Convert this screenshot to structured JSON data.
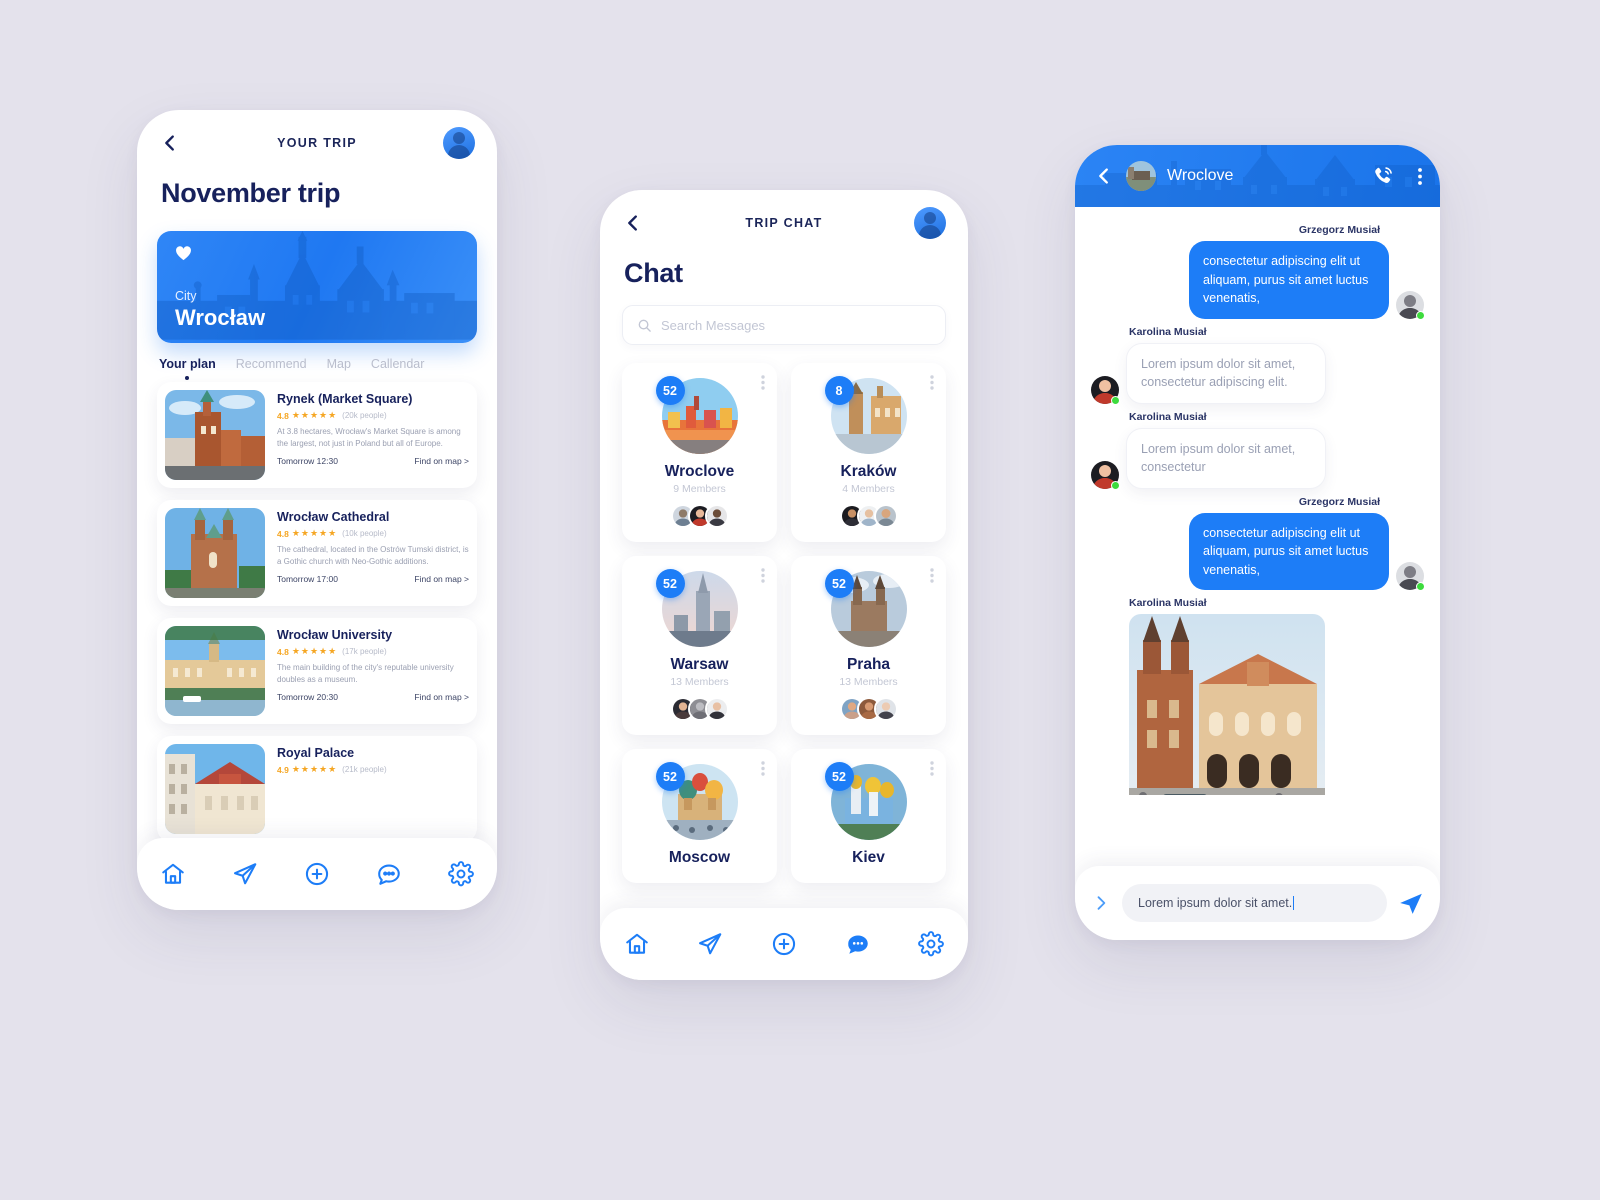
{
  "theme": {
    "background": "#e4e2ec",
    "accent_blue": "#1d7df7",
    "navy": "#17215c",
    "star_orange": "#f5a623",
    "online_green": "#3ddb3d"
  },
  "phone1": {
    "nav_title": "YOUR TRIP",
    "back_icon": "chevron-left-icon",
    "avatar_icon": "user-avatar",
    "page_title": "November trip",
    "hero": {
      "favorite_icon": "heart-icon",
      "label": "City",
      "city": "Wrocław"
    },
    "tabs": [
      {
        "label": "Your plan",
        "active": true
      },
      {
        "label": "Recommend",
        "active": false
      },
      {
        "label": "Map",
        "active": false
      },
      {
        "label": "Callendar",
        "active": false
      }
    ],
    "places": [
      {
        "title": "Rynek (Market Square)",
        "rating": "4.8",
        "stars": "★★★★★",
        "people": "(20k people)",
        "description": "At 3.8 hectares, Wrocław's Market Square is among the largest, not just in Poland but all of Europe.",
        "time": "Tomorrow 12:30",
        "link": "Find on map >"
      },
      {
        "title": "Wrocław Cathedral",
        "rating": "4.8",
        "stars": "★★★★★",
        "people": "(10k people)",
        "description": "The cathedral, located in the Ostrów Tumski district, is a Gothic church with Neo-Gothic additions.",
        "time": "Tomorrow 17:00",
        "link": "Find on map >"
      },
      {
        "title": "Wrocław University",
        "rating": "4.8",
        "stars": "★★★★★",
        "people": "(17k people)",
        "description": "The main building of the city's reputable university doubles as a museum.",
        "time": "Tomorrow 20:30",
        "link": "Find on map >"
      },
      {
        "title": "Royal Palace",
        "rating": "4.9",
        "stars": "★★★★★",
        "people": "(21k people)",
        "description": "",
        "time": "",
        "link": ""
      }
    ],
    "bottom_nav": [
      {
        "icon": "home-icon",
        "active": false
      },
      {
        "icon": "paper-plane-icon",
        "active": false
      },
      {
        "icon": "plus-circle-icon",
        "active": false
      },
      {
        "icon": "chat-bubble-icon",
        "active": false
      },
      {
        "icon": "gear-icon",
        "active": false
      }
    ]
  },
  "phone2": {
    "nav_title": "TRIP CHAT",
    "back_icon": "chevron-left-icon",
    "avatar_icon": "user-avatar",
    "page_title": "Chat",
    "search": {
      "icon": "search-icon",
      "placeholder": "Search Messages"
    },
    "groups": [
      {
        "name": "Wroclove",
        "badge": "52",
        "members": "9 Members",
        "menu_icon": "kebab-menu-icon"
      },
      {
        "name": "Kraków",
        "badge": "8",
        "members": "4 Members",
        "menu_icon": "kebab-menu-icon"
      },
      {
        "name": "Warsaw",
        "badge": "52",
        "members": "13 Members",
        "menu_icon": "kebab-menu-icon"
      },
      {
        "name": "Praha",
        "badge": "52",
        "members": "13 Members",
        "menu_icon": "kebab-menu-icon"
      },
      {
        "name": "Moscow",
        "badge": "52",
        "members": "",
        "menu_icon": "kebab-menu-icon"
      },
      {
        "name": "Kiev",
        "badge": "52",
        "members": "",
        "menu_icon": "kebab-menu-icon"
      }
    ],
    "bottom_nav": [
      {
        "icon": "home-icon",
        "active": false
      },
      {
        "icon": "paper-plane-icon",
        "active": false
      },
      {
        "icon": "plus-circle-icon",
        "active": false
      },
      {
        "icon": "chat-bubble-icon",
        "active": true
      },
      {
        "icon": "gear-icon",
        "active": false
      }
    ]
  },
  "phone3": {
    "back_icon": "chevron-left-icon",
    "group_avatar": "group-avatar",
    "group_name": "Wroclove",
    "call_icon": "phone-call-icon",
    "menu_icon": "kebab-menu-icon",
    "messages": [
      {
        "sender": "Grzegorz Musiał",
        "side": "out",
        "type": "text",
        "text": "consectetur adipiscing elit ut aliquam, purus sit amet luctus venenatis,"
      },
      {
        "sender": "Karolina Musiał",
        "side": "in",
        "type": "text",
        "text": "Lorem ipsum dolor sit amet, consectetur adipiscing elit."
      },
      {
        "sender": "Karolina Musiał",
        "side": "in",
        "type": "text",
        "text": "Lorem ipsum dolor sit amet, consectetur"
      },
      {
        "sender": "Grzegorz Musiał",
        "side": "out",
        "type": "text",
        "text": "consectetur adipiscing elit ut aliquam, purus sit amet luctus venenatis,"
      },
      {
        "sender": "Karolina Musiał",
        "side": "in",
        "type": "photo",
        "text": ""
      }
    ],
    "composer": {
      "expand_icon": "chevron-right-icon",
      "input_value": "Lorem ipsum dolor sit amet.",
      "send_icon": "send-icon"
    }
  }
}
